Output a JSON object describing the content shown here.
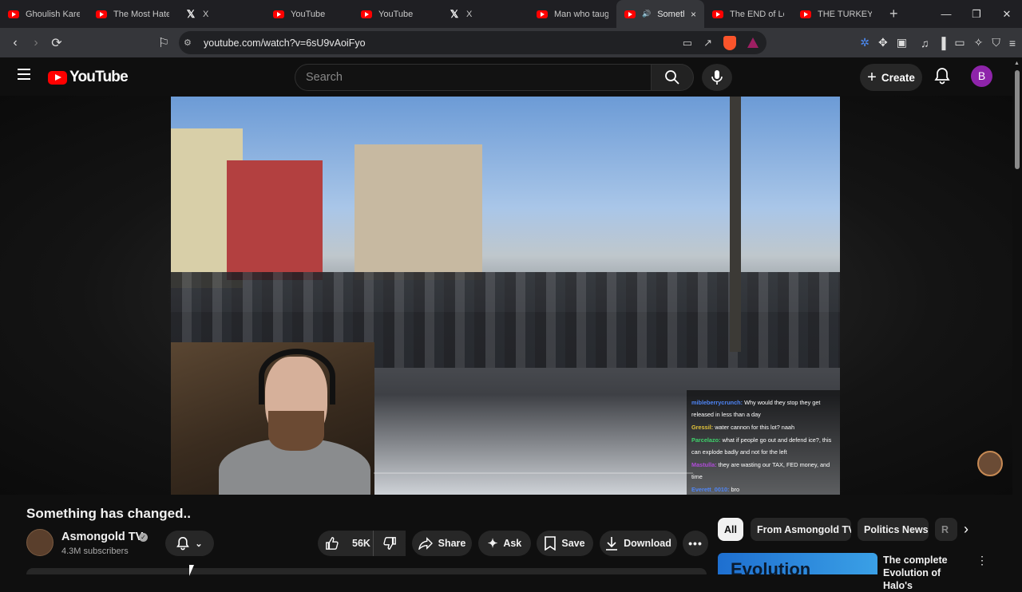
{
  "browser": {
    "tabs": [
      {
        "icon": "youtube",
        "title": "Ghoulish Karen"
      },
      {
        "icon": "youtube",
        "title": "The Most Hated"
      },
      {
        "icon": "x",
        "title": "X"
      },
      {
        "icon": "youtube",
        "title": "YouTube"
      },
      {
        "icon": "youtube",
        "title": "YouTube"
      },
      {
        "icon": "x",
        "title": "X"
      },
      {
        "icon": "youtube",
        "title": "Man who taugh"
      },
      {
        "icon": "youtube",
        "title": "Someth",
        "active": true,
        "audio": true
      },
      {
        "icon": "youtube",
        "title": "The END of Lol"
      },
      {
        "icon": "youtube",
        "title": "THE TURKEY TO"
      }
    ],
    "url": "youtube.com/watch?v=6sU9vAoiFyo",
    "new_tab": "+",
    "tab_close": "×"
  },
  "youtube": {
    "logo_text": "YouTube",
    "search_placeholder": "Search",
    "create_label": "Create",
    "avatar_letter": "B",
    "accent_color": "#ff0000"
  },
  "video": {
    "title": "Something has changed..",
    "progress": 0.0,
    "chat": [
      {
        "user": "mibleberrycrunch:",
        "color": "#4f86f7",
        "text": "Why would they stop they get released in less than a day"
      },
      {
        "user": "Gressil:",
        "color": "#e2c33a",
        "text": "water cannon for this lot? naah"
      },
      {
        "user": "Parcelazo:",
        "color": "#3fd16b",
        "text": "what if people go out and defend ice?, this can explode badly and not for the left"
      },
      {
        "user": "Mastulla:",
        "color": "#b04bd8",
        "text": "they are wasting our TAX, FED money, and time"
      },
      {
        "user": "Everett_0010:",
        "color": "#4f86f7",
        "text": "bro"
      }
    ]
  },
  "channel": {
    "name": "Asmongold TV",
    "subscribers": "4.3M subscribers"
  },
  "actions": {
    "likes": "56K",
    "share": "Share",
    "ask": "Ask",
    "save": "Save",
    "download": "Download"
  },
  "chips": [
    "All",
    "From Asmongold TV",
    "Politics News",
    "R"
  ],
  "recommendation": {
    "thumb_text": "Evolution",
    "title": "The complete Evolution of Halo's"
  }
}
